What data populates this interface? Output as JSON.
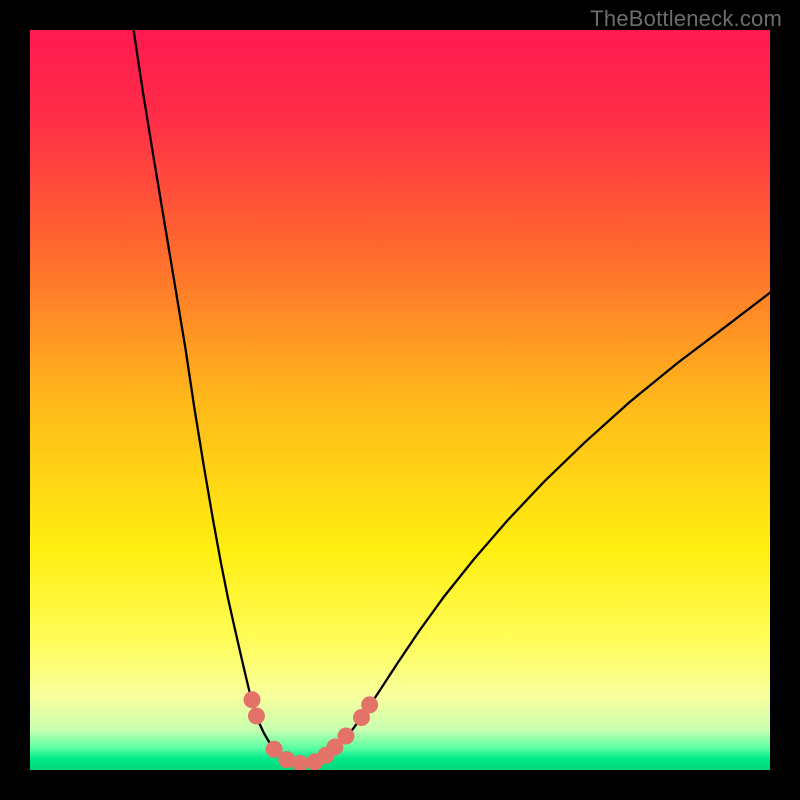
{
  "watermark": "TheBottleneck.com",
  "chart_data": {
    "type": "line",
    "title": "",
    "xlabel": "",
    "ylabel": "",
    "xlim": [
      0,
      100
    ],
    "ylim": [
      0,
      100
    ],
    "background_gradient": {
      "stops": [
        {
          "offset": 0.0,
          "color": "#ff1a50"
        },
        {
          "offset": 0.12,
          "color": "#ff2e48"
        },
        {
          "offset": 0.3,
          "color": "#ff6a2e"
        },
        {
          "offset": 0.5,
          "color": "#ffb81a"
        },
        {
          "offset": 0.7,
          "color": "#ffee10"
        },
        {
          "offset": 0.82,
          "color": "#fffc55"
        },
        {
          "offset": 0.9,
          "color": "#f8ff9c"
        },
        {
          "offset": 0.945,
          "color": "#c9ffb0"
        },
        {
          "offset": 0.97,
          "color": "#5cffa2"
        },
        {
          "offset": 0.985,
          "color": "#00e889"
        },
        {
          "offset": 1.0,
          "color": "#00d878"
        }
      ]
    },
    "series": [
      {
        "name": "left-curve",
        "color": "#000000",
        "width": 2.3,
        "x": [
          14.0,
          15.2,
          16.5,
          18.0,
          19.5,
          21.0,
          22.2,
          23.5,
          24.7,
          25.8,
          26.8,
          27.7,
          28.5,
          29.2,
          29.8,
          30.4,
          31.0,
          31.6,
          32.3,
          33.1,
          34.0
        ],
        "y": [
          100.0,
          92.0,
          84.0,
          75.0,
          66.0,
          57.0,
          49.0,
          41.0,
          34.0,
          28.0,
          23.0,
          19.0,
          15.5,
          12.5,
          10.0,
          8.0,
          6.3,
          5.0,
          3.8,
          2.8,
          2.0
        ]
      },
      {
        "name": "right-curve",
        "color": "#000000",
        "width": 2.3,
        "x": [
          40.0,
          41.0,
          42.2,
          43.6,
          45.3,
          47.3,
          49.7,
          52.6,
          56.0,
          60.0,
          64.5,
          69.5,
          75.0,
          81.0,
          87.5,
          94.5,
          100.0
        ],
        "y": [
          2.0,
          2.8,
          3.9,
          5.5,
          7.8,
          10.8,
          14.5,
          18.8,
          23.5,
          28.5,
          33.7,
          39.0,
          44.3,
          49.7,
          55.0,
          60.3,
          64.5
        ]
      },
      {
        "name": "floor-curve",
        "color": "#000000",
        "width": 2.3,
        "x": [
          34.0,
          34.8,
          35.6,
          36.5,
          37.5,
          38.5,
          39.3,
          40.0
        ],
        "y": [
          2.0,
          1.3,
          0.9,
          0.7,
          0.7,
          0.9,
          1.3,
          2.0
        ]
      }
    ],
    "scatter": {
      "name": "markers",
      "color": "#e37368",
      "radius": 8.5,
      "points": [
        {
          "x": 30.0,
          "y": 9.5
        },
        {
          "x": 30.6,
          "y": 7.3
        },
        {
          "x": 33.0,
          "y": 2.8
        },
        {
          "x": 34.7,
          "y": 1.4
        },
        {
          "x": 36.5,
          "y": 0.9
        },
        {
          "x": 38.5,
          "y": 1.1
        },
        {
          "x": 40.0,
          "y": 2.0
        },
        {
          "x": 41.2,
          "y": 3.1
        },
        {
          "x": 42.7,
          "y": 4.6
        },
        {
          "x": 44.8,
          "y": 7.1
        },
        {
          "x": 45.9,
          "y": 8.8
        }
      ]
    }
  }
}
